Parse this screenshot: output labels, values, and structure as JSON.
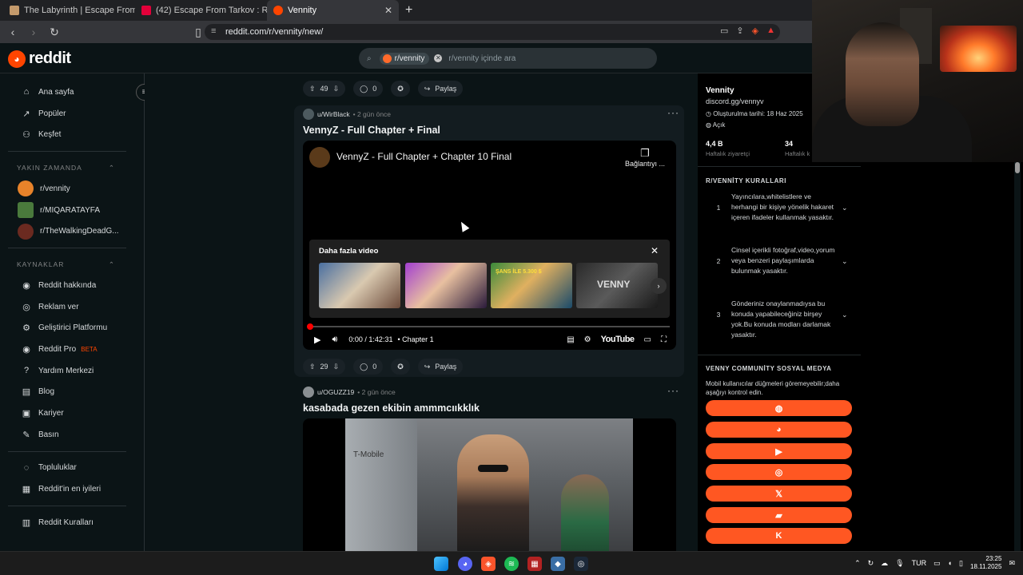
{
  "browser": {
    "tabs": [
      {
        "label": "The Labyrinth | Escape From Tarkov I",
        "color": "#c49a6c",
        "active": false
      },
      {
        "label": "(42) Escape From Tarkov : RTX 4090 2",
        "color": "#e3003a",
        "active": false
      },
      {
        "label": "Vennity",
        "color": "#ff4500",
        "active": true
      }
    ],
    "new_tab": "+",
    "url": "reddit.com/r/vennity/new/"
  },
  "header": {
    "logo_text": "reddit",
    "search_chip": "r/vennity",
    "search_placeholder": "r/vennity içinde ara"
  },
  "left_nav": {
    "main": [
      {
        "label": "Ana sayfa",
        "icon": "home-icon",
        "glyph": "⌂"
      },
      {
        "label": "Popüler",
        "icon": "popular-icon",
        "glyph": "↗"
      },
      {
        "label": "Keşfet",
        "icon": "explore-icon",
        "glyph": "⚇"
      }
    ],
    "recent_title": "YAKIN ZAMANDA",
    "recent": [
      {
        "label": "r/vennity",
        "color": "#e8832a"
      },
      {
        "label": "r/MIQARATAYFA",
        "color": "#4a7a3c"
      },
      {
        "label": "r/TheWalkingDeadG...",
        "color": "#6b2a20"
      }
    ],
    "resources_title": "KAYNAKLAR",
    "resources": [
      {
        "label": "Reddit hakkında",
        "icon": "reddit-about-icon",
        "glyph": "◉"
      },
      {
        "label": "Reklam ver",
        "icon": "advertise-icon",
        "glyph": "◎"
      },
      {
        "label": "Geliştirici Platformu",
        "icon": "developer-icon",
        "glyph": "⚙"
      },
      {
        "label": "Reddit Pro",
        "icon": "reddit-pro-icon",
        "glyph": "◉",
        "badge": "BETA"
      },
      {
        "label": "Yardım Merkezi",
        "icon": "help-icon",
        "glyph": "?"
      },
      {
        "label": "Blog",
        "icon": "blog-icon",
        "glyph": "▤"
      },
      {
        "label": "Kariyer",
        "icon": "career-icon",
        "glyph": "▣"
      },
      {
        "label": "Basın",
        "icon": "press-icon",
        "glyph": "✎"
      }
    ],
    "communities": [
      {
        "label": "Topluluklar",
        "icon": "communities-icon",
        "glyph": "◌"
      },
      {
        "label": "Reddit'in en iyileri",
        "icon": "best-of-icon",
        "glyph": "▦"
      }
    ],
    "rules": [
      {
        "label": "Reddit Kuralları",
        "icon": "rules-icon",
        "glyph": "▥"
      }
    ]
  },
  "feed": {
    "top_actions": {
      "votes": "49",
      "comments": "0",
      "share": "Paylaş"
    },
    "post1": {
      "user": "u/WirBlack",
      "time": "• 2 gün önce",
      "title": "VennyZ - Full Chapter + Final",
      "video_title": "VennyZ - Full Chapter + Chapter 10 Final",
      "copy_label": "Bağlantıyı ...",
      "more_videos": "Daha fazla video",
      "time_display": "0:00 / 1:42:31",
      "chapter": "• Chapter 1",
      "yt_label": "YouTube",
      "votes": "29",
      "comments": "0",
      "share": "Paylaş",
      "thumb_text_1": "ŞANS İLE 5.300 $",
      "thumb_text_2": "VENNY"
    },
    "post2": {
      "user": "u/OGUZZ19",
      "time": "• 2 gün önce",
      "title": "kasabada gezen ekibin ammmcııkklık",
      "wall_text": "T-Mobile"
    }
  },
  "right_sidebar": {
    "name": "Vennity",
    "link": "discord.gg/vennyv",
    "created": "Oluşturulma tarihi: 18 Haz 2025",
    "status": "Açık",
    "stat1_value": "4,4 B",
    "stat1_label": "Haftalık ziyaretçi",
    "stat2_value": "34",
    "stat2_label": "Haftalık k",
    "rules_title": "R/VENNİTY KURALLARI",
    "rules": [
      {
        "num": "1",
        "text": "Yayıncılara,whitelistlere ve herhangi bir kişiye yönelik hakaret içeren ifadeler kullanmak yasaktır."
      },
      {
        "num": "2",
        "text": "Cinsel içerikli fotoğraf,video,yorum veya benzeri paylaşımlarda bulunmak yasaktır."
      },
      {
        "num": "3",
        "text": "Gönderiniz onaylanmadıysa bu konuda yapabileceğiniz birşey yok.Bu konuda modları darlamak yasaktır."
      }
    ],
    "social_title": "VENNY COMMUNİTY SOSYAL MEDYA",
    "social_note": "Mobil kullanıcılar düğmeleri göremeyebilir;daha aşağıyı kontrol edin.",
    "social_buttons": [
      {
        "name": "website-icon",
        "glyph": "◍"
      },
      {
        "name": "discord-icon",
        "glyph": "◕"
      },
      {
        "name": "youtube-icon",
        "glyph": "▶"
      },
      {
        "name": "instagram-icon",
        "glyph": "◎"
      },
      {
        "name": "x-icon",
        "glyph": "𝕏"
      },
      {
        "name": "twitch-icon",
        "glyph": "▰"
      },
      {
        "name": "kick-icon",
        "glyph": "K"
      }
    ]
  },
  "taskbar": {
    "lang": "TUR",
    "time": "23:25",
    "date": "18.11.2025"
  }
}
